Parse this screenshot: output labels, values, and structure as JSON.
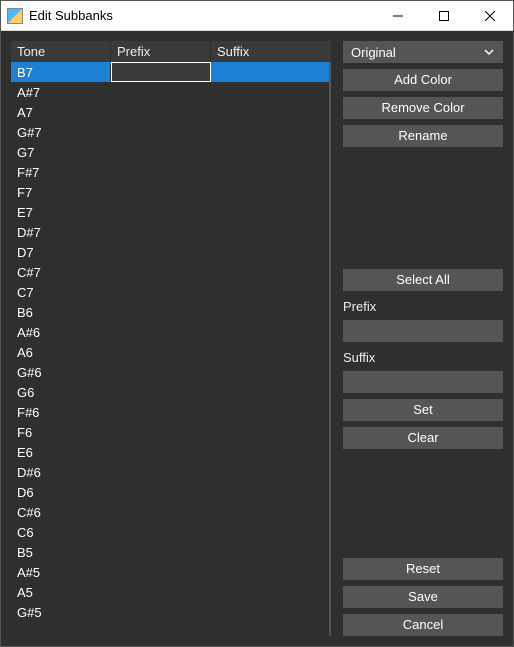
{
  "window": {
    "title": "Edit Subbanks"
  },
  "table": {
    "headers": {
      "tone": "Tone",
      "prefix": "Prefix",
      "suffix": "Suffix"
    },
    "rows": [
      {
        "tone": "B7",
        "prefix": "",
        "suffix": "",
        "selected": true,
        "editingPrefix": true
      },
      {
        "tone": "A#7",
        "prefix": "",
        "suffix": ""
      },
      {
        "tone": "A7",
        "prefix": "",
        "suffix": ""
      },
      {
        "tone": "G#7",
        "prefix": "",
        "suffix": ""
      },
      {
        "tone": "G7",
        "prefix": "",
        "suffix": ""
      },
      {
        "tone": "F#7",
        "prefix": "",
        "suffix": ""
      },
      {
        "tone": "F7",
        "prefix": "",
        "suffix": ""
      },
      {
        "tone": "E7",
        "prefix": "",
        "suffix": ""
      },
      {
        "tone": "D#7",
        "prefix": "",
        "suffix": ""
      },
      {
        "tone": "D7",
        "prefix": "",
        "suffix": ""
      },
      {
        "tone": "C#7",
        "prefix": "",
        "suffix": ""
      },
      {
        "tone": "C7",
        "prefix": "",
        "suffix": ""
      },
      {
        "tone": "B6",
        "prefix": "",
        "suffix": ""
      },
      {
        "tone": "A#6",
        "prefix": "",
        "suffix": ""
      },
      {
        "tone": "A6",
        "prefix": "",
        "suffix": ""
      },
      {
        "tone": "G#6",
        "prefix": "",
        "suffix": ""
      },
      {
        "tone": "G6",
        "prefix": "",
        "suffix": ""
      },
      {
        "tone": "F#6",
        "prefix": "",
        "suffix": ""
      },
      {
        "tone": "F6",
        "prefix": "",
        "suffix": ""
      },
      {
        "tone": "E6",
        "prefix": "",
        "suffix": ""
      },
      {
        "tone": "D#6",
        "prefix": "",
        "suffix": ""
      },
      {
        "tone": "D6",
        "prefix": "",
        "suffix": ""
      },
      {
        "tone": "C#6",
        "prefix": "",
        "suffix": ""
      },
      {
        "tone": "C6",
        "prefix": "",
        "suffix": ""
      },
      {
        "tone": "B5",
        "prefix": "",
        "suffix": ""
      },
      {
        "tone": "A#5",
        "prefix": "",
        "suffix": ""
      },
      {
        "tone": "A5",
        "prefix": "",
        "suffix": ""
      },
      {
        "tone": "G#5",
        "prefix": "",
        "suffix": ""
      }
    ]
  },
  "side": {
    "color_select": "Original",
    "add_color": "Add Color",
    "remove_color": "Remove Color",
    "rename": "Rename",
    "select_all": "Select All",
    "prefix_label": "Prefix",
    "prefix_value": "",
    "suffix_label": "Suffix",
    "suffix_value": "",
    "set": "Set",
    "clear": "Clear",
    "reset": "Reset",
    "save": "Save",
    "cancel": "Cancel"
  }
}
